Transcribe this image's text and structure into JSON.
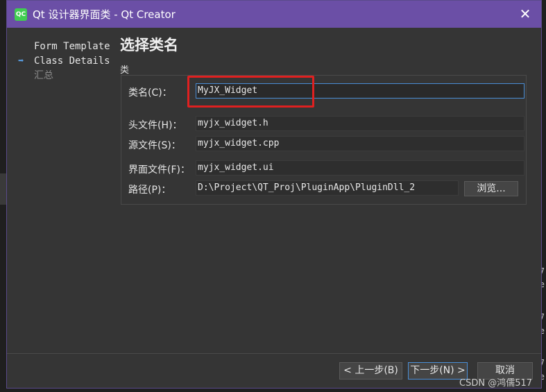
{
  "window": {
    "app_icon_text": "QC",
    "title": "Qt 设计器界面类 - Qt Creator",
    "close_glyph": "✕"
  },
  "steps": [
    {
      "label": "Form Template",
      "current": false
    },
    {
      "label": "Class Details",
      "current": true
    },
    {
      "label": "汇总",
      "current": false
    }
  ],
  "page_title": "选择类名",
  "section_label": "类",
  "fields": {
    "class_name": {
      "label": "类名(C)：",
      "value": "MyJX_Widget"
    },
    "header_file": {
      "label": "头文件(H)：",
      "value": "myjx_widget.h"
    },
    "source_file": {
      "label": "源文件(S)：",
      "value": "myjx_widget.cpp"
    },
    "form_file": {
      "label": "界面文件(F)：",
      "value": "myjx_widget.ui"
    },
    "path": {
      "label": "路径(P)：",
      "value": "D:\\Project\\QT_Proj\\PluginApp\\PluginDll_2"
    }
  },
  "browse_label": "浏览...",
  "buttons": {
    "back": "< 上一步(B)",
    "next": "下一步(N) >",
    "cancel": "取消"
  },
  "watermark": "CSDN @鸿儒517",
  "background_text": [
    "7",
    "e",
    "7",
    "e",
    "7",
    "e"
  ],
  "colors": {
    "titlebar": "#6b4fa6",
    "highlight": "#e02020",
    "focus": "#4a8ed6"
  }
}
